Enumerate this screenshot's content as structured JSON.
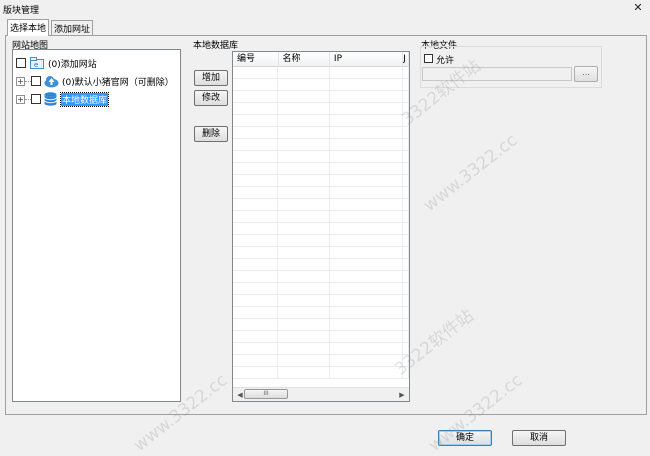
{
  "window": {
    "title": "版块管理",
    "close_glyph": "✕"
  },
  "tabs": [
    {
      "label": "选择本地",
      "active": true
    },
    {
      "label": "添加网址",
      "active": false
    }
  ],
  "site_map": {
    "group_title": "网站地图",
    "tree": [
      {
        "label": "(0)添加网站",
        "icon": "folder-icon",
        "checked": false
      },
      {
        "label": "(0)默认小猪官网（可删除）",
        "icon": "cloud-upload-icon",
        "checked": false
      },
      {
        "label": "本地数据库",
        "icon": "database-icon",
        "checked": false,
        "selected": true
      }
    ]
  },
  "local_db": {
    "group_title": "本地数据库",
    "buttons": {
      "add": "增加",
      "edit": "修改",
      "delete": "删除"
    },
    "columns": [
      "编号",
      "名称",
      "IP",
      "J"
    ],
    "scroll_thumb_glyph": "III"
  },
  "local_file": {
    "group_title": "本地文件",
    "allow_label": "允许",
    "allow_checked": false,
    "path_value": "",
    "browse_label": "..."
  },
  "footer": {
    "ok_label": "确定",
    "cancel_label": "取消"
  },
  "watermarks": [
    "www.3322.cc",
    "www.3322.cc",
    "www.3322.cc",
    "3322软件站",
    "3322软件站"
  ]
}
